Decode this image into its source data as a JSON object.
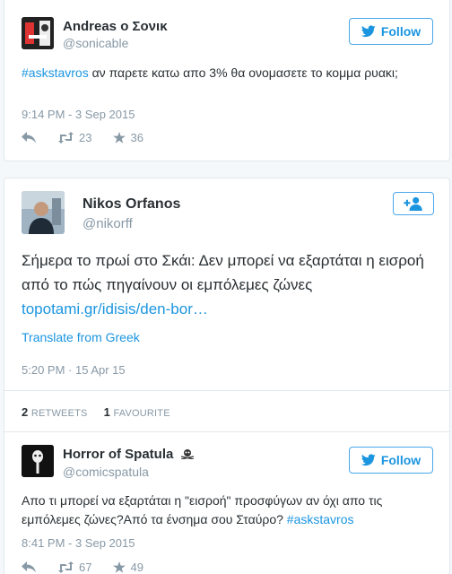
{
  "tweet1": {
    "name": "Andreas ο Σονικ",
    "handle": "@sonicable",
    "follow_label": "Follow",
    "hashtag": "#askstavros",
    "text": " αν παρετε κατω απο 3% θα ονομασετε το κομμα ρυακι;",
    "timestamp": "9:14 PM - 3 Sep 2015",
    "retweets": "23",
    "favorites": "36"
  },
  "tweet2": {
    "name": "Nikos Orfanos",
    "handle": "@nikorff",
    "text": "Σήμερα το πρωί στο Σκάι: Δεν μπορεί να εξαρτάται η εισροή από το πώς πηγαίνουν οι εμπόλεμες ζώνες",
    "link": "topotami.gr/idisis/den-bor…",
    "translate_label": "Translate from Greek",
    "timestamp": "5:20 PM · 15 Apr 15",
    "retweet_count": "2",
    "retweet_label": "RETWEETS",
    "favourite_count": "1",
    "favourite_label": "FAVOURITE"
  },
  "tweet3": {
    "name": "Horror of Spatula",
    "handle": "@comicspatula",
    "follow_label": "Follow",
    "text": "Απο τι μπορεί να εξαρτάται η \"εισροή\" προσφύγων αν όχι απο τις εμπόλεμες ζώνες?Από τα ένσημα σου Σταύρο? ",
    "hashtag": "#askstavros",
    "timestamp": "8:41 PM - 3 Sep 2015",
    "retweets": "67",
    "favorites": "49"
  },
  "colors": {
    "accent": "#1b95e0",
    "muted": "#8899a6",
    "border": "#e1e8ed"
  },
  "icons": [
    "twitter-bird-icon",
    "reply-icon",
    "retweet-icon",
    "star-icon",
    "add-user-icon",
    "skull-icon"
  ]
}
